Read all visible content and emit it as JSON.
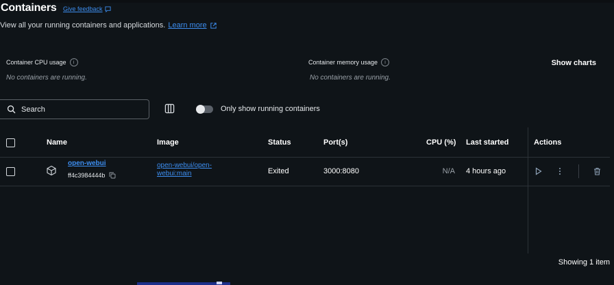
{
  "page": {
    "title": "Containers",
    "feedback_link": "Give feedback",
    "subtitle": "View all your running containers and applications.",
    "learn_more": "Learn more"
  },
  "metrics": {
    "cpu": {
      "label": "Container CPU usage",
      "value": "No containers are running."
    },
    "memory": {
      "label": "Container memory usage",
      "value": "No containers are running."
    },
    "show_charts": "Show charts"
  },
  "toolbar": {
    "search_placeholder": "Search",
    "toggle_label": "Only show running containers",
    "toggle_on": false
  },
  "table": {
    "headers": {
      "name": "Name",
      "image": "Image",
      "status": "Status",
      "ports": "Port(s)",
      "cpu": "CPU (%)",
      "last_started": "Last started",
      "actions": "Actions"
    },
    "rows": [
      {
        "name": "open-webui",
        "id": "ff4c3984444b",
        "image": "open-webui/open-webui:main",
        "status": "Exited",
        "ports": "3000:8080",
        "cpu": "N/A",
        "last_started": "4 hours ago"
      }
    ]
  },
  "footer": {
    "count": "Showing 1 item"
  },
  "icons": {
    "info": "info-icon",
    "external": "external-link-icon",
    "search": "search-icon",
    "columns": "columns-icon",
    "container": "cube-icon",
    "copy": "copy-icon",
    "play": "play-icon",
    "more": "more-vertical-icon",
    "delete": "trash-icon"
  },
  "colors": {
    "accent": "#3d8ef0",
    "background": "#0f1418"
  }
}
